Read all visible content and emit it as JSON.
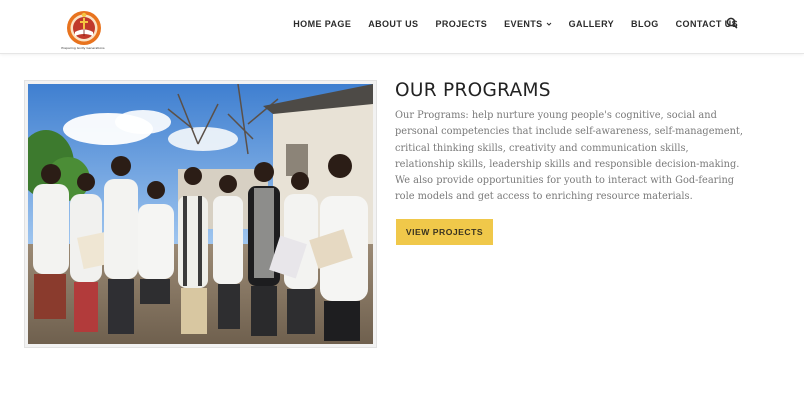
{
  "header": {
    "logo": {
      "icon": "cross-book-emblem",
      "tagline": "Preparing Godly Generations"
    },
    "nav": [
      {
        "label": "HOME PAGE"
      },
      {
        "label": "ABOUT US"
      },
      {
        "label": "PROJECTS"
      },
      {
        "label": "EVENTS",
        "has_dropdown": true
      },
      {
        "label": "GALLERY"
      },
      {
        "label": "BLOG"
      },
      {
        "label": "CONTACT US"
      }
    ],
    "search_icon": "search-icon"
  },
  "programs": {
    "title": "OUR PROGRAMS",
    "body": "Our Programs: help nurture young people's cognitive, social and personal competencies that include self-awareness, self-management, critical thinking skills, creativity and communication skills, relationship skills, leadership skills and responsible decision-making. We also provide opportunities for youth to interact with God-fearing role models and get access to enriching resource materials.",
    "button_label": "VIEW PROJECTS"
  },
  "colors": {
    "accent": "#f0c84a",
    "logo_ring": "#e8731e",
    "logo_inner": "#c0392b",
    "text_body": "#7a7a7a",
    "heading": "#222222"
  }
}
